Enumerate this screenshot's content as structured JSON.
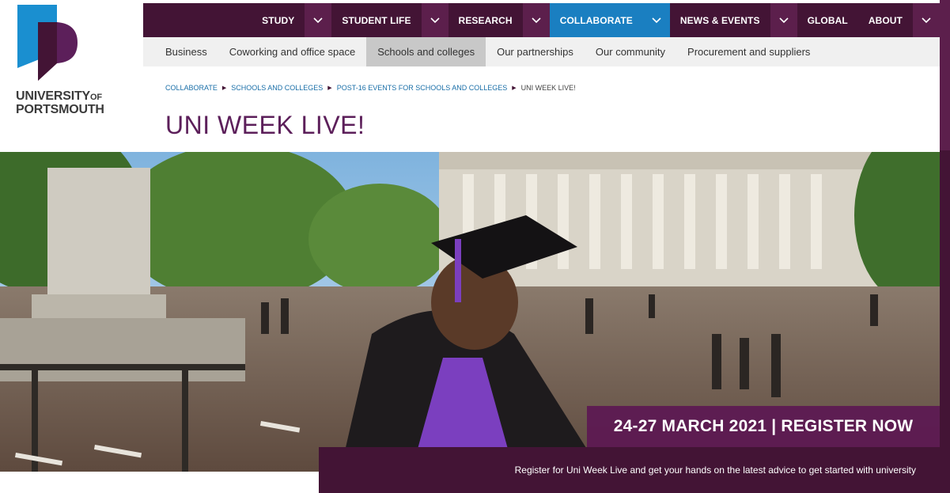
{
  "logo": {
    "line1": "UNIVERSITY",
    "of": "OF",
    "line2": "PORTSMOUTH"
  },
  "nav": {
    "items": [
      {
        "label": "STUDY",
        "has_dropdown": true
      },
      {
        "label": "STUDENT LIFE",
        "has_dropdown": true
      },
      {
        "label": "RESEARCH",
        "has_dropdown": true
      },
      {
        "label": "COLLABORATE",
        "has_dropdown": true,
        "active": true
      },
      {
        "label": "NEWS & EVENTS",
        "has_dropdown": true
      },
      {
        "label": "GLOBAL",
        "has_dropdown": false
      },
      {
        "label": "ABOUT",
        "has_dropdown": true
      }
    ]
  },
  "subnav": {
    "items": [
      {
        "label": "Business"
      },
      {
        "label": "Coworking and office space"
      },
      {
        "label": "Schools and colleges",
        "active": true
      },
      {
        "label": "Our partnerships"
      },
      {
        "label": "Our community"
      },
      {
        "label": "Procurement and suppliers"
      }
    ]
  },
  "breadcrumb": {
    "items": [
      "COLLABORATE",
      "SCHOOLS AND COLLEGES",
      "POST-16 EVENTS FOR SCHOOLS AND COLLEGES",
      "UNI WEEK LIVE!"
    ]
  },
  "page": {
    "title": "UNI WEEK LIVE!"
  },
  "hero": {
    "banner": "24-27 MARCH 2021 | REGISTER NOW",
    "caption": "Register for Uni Week Live and get your hands on the latest advice to get started with university"
  },
  "colors": {
    "brand_purple": "#431435",
    "accent_blue": "#1a7fc1",
    "title_purple": "#5c1f5a"
  }
}
